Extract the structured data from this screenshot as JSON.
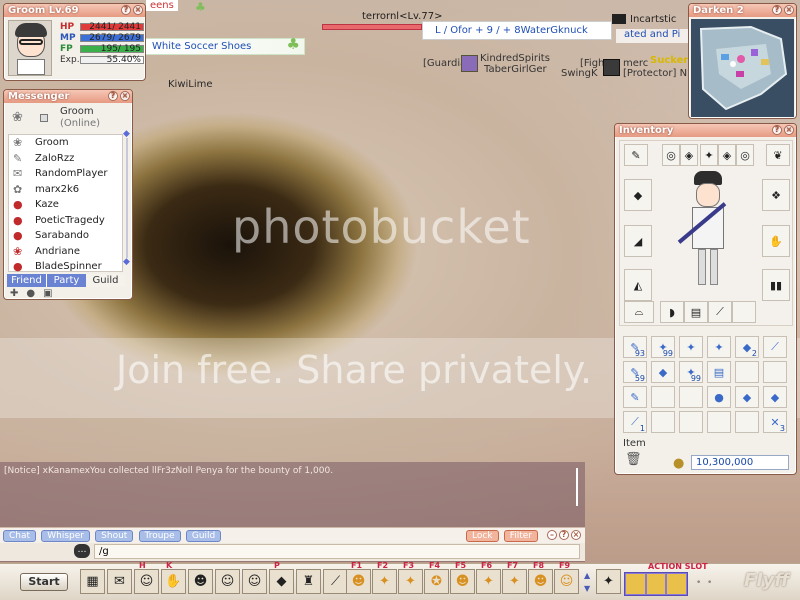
{
  "status": {
    "title": "Groom Lv.69",
    "hp_label": "HP",
    "hp_text": "2441/ 2441",
    "hp_fraction": 1.0,
    "mp_label": "MP",
    "mp_text": "2679/ 2679",
    "mp_fraction": 1.0,
    "fp_label": "FP",
    "fp_text": "195/ 195",
    "fp_fraction": 1.0,
    "exp_label": "Exp.",
    "exp_text": "55.40%",
    "exp_fraction": 0.554
  },
  "world": {
    "top_fragment": "eens",
    "white_soccer": "White Soccer Shoes",
    "player_name": "terrornl<Lv.77>",
    "trade_text": "L / Ofor + 9 / + 8WaterGknuck",
    "incarn": "Incartstic",
    "ated": "ated and Pi",
    "kindred": "KindredSpirits",
    "guardian": "[Guardia",
    "taber": "TaberGirlGer",
    "fight": "[Figh",
    "merc": "merc",
    "suckers": "Suckers",
    "protector": "[Protector] N",
    "swingk": "SwingK",
    "kiwilime": "KiwiLime"
  },
  "minimap": {
    "title": "Darken 2"
  },
  "messenger": {
    "title": "Messenger",
    "me_name": "Groom",
    "me_status": "(Online)",
    "friends": [
      "Groom",
      "ZaloRzz",
      "RandomPlayer",
      "marx2k6",
      "Kaze",
      "PoeticTragedy",
      "Sarabando",
      "Andriane",
      "BladeSpinner"
    ],
    "tabs": [
      "Friend",
      "Party",
      "Guild"
    ]
  },
  "inventory": {
    "title": "Inventory",
    "item_label": "Item",
    "penya": "10,300,000",
    "row1": [
      "93",
      "99",
      "",
      "",
      "2",
      ""
    ],
    "row2": [
      "59",
      "",
      "99",
      "",
      "",
      ""
    ],
    "row4": [
      "1",
      "",
      "",
      "",
      "",
      "3"
    ]
  },
  "chat": {
    "notice": "[Notice] xKanamexYou collected llFr3zNoll Penya for the bounty of 1,000.",
    "tabs": [
      "Chat",
      "Whisper",
      "Shout",
      "Troupe",
      "Guild"
    ],
    "lock": "Lock",
    "filter": "Filter",
    "input_value": "/g"
  },
  "taskbar": {
    "start": "Start",
    "keys_left": [
      "H",
      "K",
      "P"
    ],
    "fkeys": [
      "F1",
      "F2",
      "F3",
      "F4",
      "F5",
      "F6",
      "F7",
      "F8",
      "F9"
    ],
    "action_slot": "ACTION SLOT",
    "logo": "Flyff"
  },
  "watermark": {
    "brand": "photobucket",
    "slogan": "Join free. Share privately."
  },
  "colors": {
    "hp": "#e03a3a",
    "mp": "#3d6fd8",
    "fp": "#3bb04a",
    "exp": "#f0f0f0",
    "accent": "#e69a82"
  }
}
